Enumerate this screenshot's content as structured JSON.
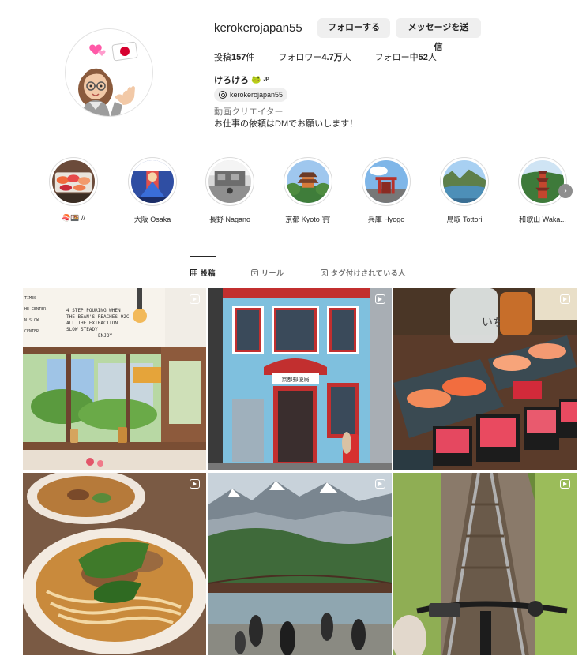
{
  "profile": {
    "username": "kerokerojapan55",
    "follow_label": "フォローする",
    "message_label": "メッセージを送信",
    "stats": {
      "posts_prefix": "投稿",
      "posts_value": "157",
      "posts_suffix": "件",
      "followers_prefix": "フォロワー",
      "followers_value": "4.7万",
      "followers_suffix": "人",
      "following_prefix": "フォロー中",
      "following_value": "52",
      "following_suffix": "人"
    },
    "full_name": "けろけろ",
    "name_emoji": "🐸",
    "name_tag": "JP",
    "threads_handle": "kerokerojapan55",
    "bio_category": "動画クリエイター",
    "bio_text": "お仕事の依頼はDMでお願いします！"
  },
  "highlights": [
    {
      "label": "🍣🍱 //",
      "icon": "sushi-thumbnail"
    },
    {
      "label": "大阪 Osaka",
      "icon": "osaka-thumbnail"
    },
    {
      "label": "長野 Nagano",
      "icon": "nagano-thumbnail"
    },
    {
      "label": "京都 Kyoto ⛩",
      "icon": "kyoto-thumbnail"
    },
    {
      "label": "兵庫 Hyogo",
      "icon": "hyogo-thumbnail"
    },
    {
      "label": "鳥取 Tottori",
      "icon": "tottori-thumbnail"
    },
    {
      "label": "和歌山 Waka...",
      "icon": "wakayama-thumbnail"
    }
  ],
  "tabs": {
    "posts": "投稿",
    "reels": "リール",
    "tagged": "タグ付けされている人"
  },
  "posts_grid": {
    "cafe_sign_lines": [
      "4 STEP POURING WHEN",
      "THE BEAN'S REACHES 92C",
      "ALL THE EXTRACTION",
      "SLOW STEADY",
      "ENJOY"
    ],
    "cafe_sign_side": [
      "TIMES",
      "HE CENTER",
      "N SLOW",
      "CENTER"
    ],
    "post_office_sign": "京都郵便局",
    "sushi_sign": "いち"
  },
  "colors": {
    "text": "#262626",
    "secondary": "#737373",
    "button_bg": "#efefef",
    "divider": "#dbdbdb"
  }
}
